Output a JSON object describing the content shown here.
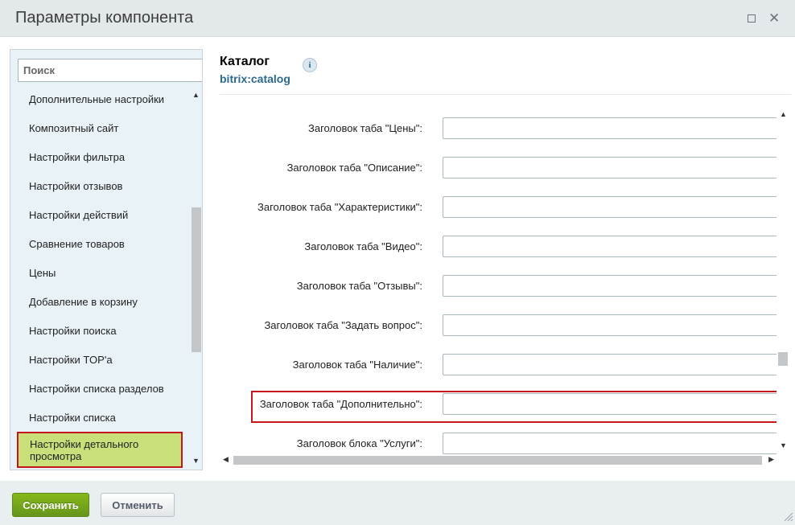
{
  "window": {
    "title": "Параметры компонента"
  },
  "sidebar": {
    "search_placeholder": "Поиск",
    "items": [
      {
        "label": "Дополнительные настройки"
      },
      {
        "label": "Композитный сайт"
      },
      {
        "label": "Настройки фильтра"
      },
      {
        "label": "Настройки отзывов"
      },
      {
        "label": "Настройки действий"
      },
      {
        "label": "Сравнение товаров"
      },
      {
        "label": "Цены"
      },
      {
        "label": "Добавление в корзину"
      },
      {
        "label": "Настройки поиска"
      },
      {
        "label": "Настройки TOP'а"
      },
      {
        "label": "Настройки списка разделов"
      },
      {
        "label": "Настройки списка"
      },
      {
        "label": "Настройки детального просмотра"
      }
    ],
    "active_index": 12
  },
  "main": {
    "title": "Каталог",
    "subtitle": "bitrix:catalog",
    "info_icon": "info-icon",
    "fields": [
      {
        "label": "Заголовок таба \"Цены\":",
        "value": ""
      },
      {
        "label": "Заголовок таба \"Описание\":",
        "value": ""
      },
      {
        "label": "Заголовок таба \"Характеристики\":",
        "value": ""
      },
      {
        "label": "Заголовок таба \"Видео\":",
        "value": ""
      },
      {
        "label": "Заголовок таба \"Отзывы\":",
        "value": ""
      },
      {
        "label": "Заголовок таба \"Задать вопрос\":",
        "value": ""
      },
      {
        "label": "Заголовок таба \"Наличие\":",
        "value": ""
      },
      {
        "label": "Заголовок таба \"Дополнительно\":",
        "value": ""
      },
      {
        "label": "Заголовок блока \"Услуги\":",
        "value": ""
      }
    ],
    "highlighted_field_index": 7
  },
  "footer": {
    "save_label": "Сохранить",
    "cancel_label": "Отменить"
  },
  "colors": {
    "save_button": "#7aaa1a",
    "highlight_border": "#c4161c",
    "active_item_bg": "#c9df7a",
    "subtitle": "#2a6a8e"
  }
}
